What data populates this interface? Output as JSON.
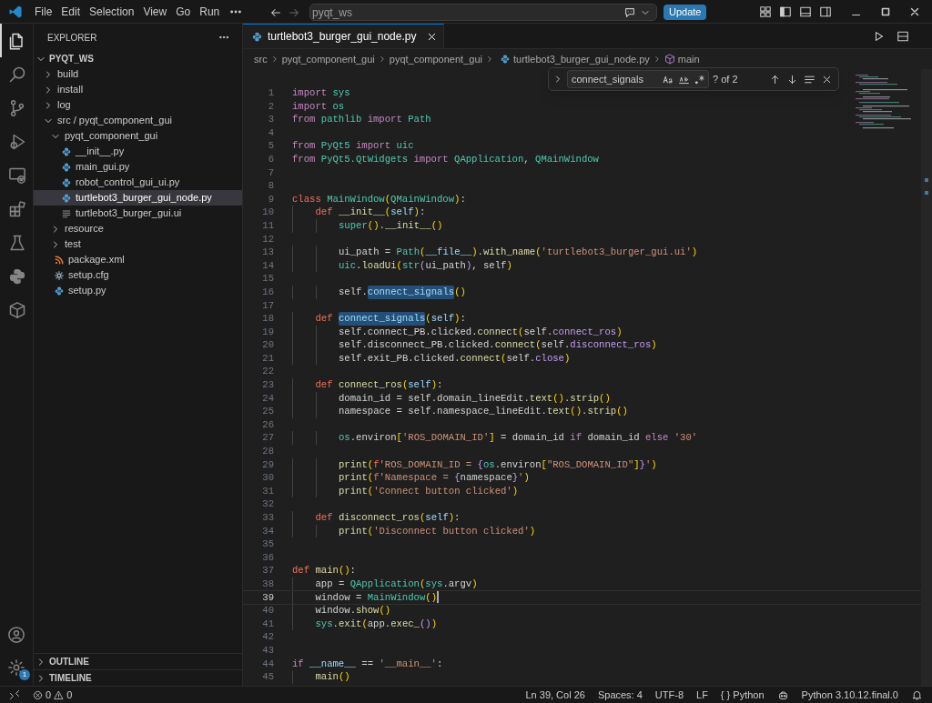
{
  "title_bar": {
    "menu": [
      "File",
      "Edit",
      "Selection",
      "View",
      "Go",
      "Run"
    ],
    "command_center": "pyqt_ws",
    "update_button": "Update"
  },
  "activity_bar": [
    {
      "kind": "files",
      "selected": true
    },
    {
      "kind": "search",
      "selected": false
    },
    {
      "kind": "source-control",
      "selected": false
    },
    {
      "kind": "debug",
      "selected": false
    },
    {
      "kind": "remote",
      "selected": false
    },
    {
      "kind": "extensions",
      "selected": false
    },
    {
      "kind": "testing",
      "selected": false
    },
    {
      "kind": "python",
      "selected": false
    },
    {
      "kind": "cube",
      "selected": false
    }
  ],
  "settings_badge": "1",
  "sidebar": {
    "title": "EXPLORER",
    "root": {
      "label": "PYQT_WS",
      "expanded": true
    },
    "tree": [
      {
        "label": "build",
        "kind": "folder",
        "expanded": false,
        "selected": false
      },
      {
        "label": "install",
        "kind": "folder",
        "expanded": false,
        "selected": false
      },
      {
        "label": "log",
        "kind": "folder",
        "expanded": false,
        "selected": false
      },
      {
        "label": "src / pyqt_component_gui",
        "kind": "folder",
        "expanded": true,
        "selected": false,
        "children": [
          {
            "label": "pyqt_component_gui",
            "kind": "folder",
            "expanded": true,
            "selected": false,
            "children": [
              {
                "label": "__init__.py",
                "kind": "python",
                "selected": false
              },
              {
                "label": "main_gui.py",
                "kind": "python",
                "selected": false
              },
              {
                "label": "robot_control_gui_ui.py",
                "kind": "python",
                "selected": false
              },
              {
                "label": "turtlebot3_burger_gui_node.py",
                "kind": "python",
                "selected": true
              },
              {
                "label": "turtlebot3_burger_gui.ui",
                "kind": "text",
                "selected": false
              }
            ]
          },
          {
            "label": "resource",
            "kind": "folder",
            "expanded": false,
            "selected": false
          },
          {
            "label": "test",
            "kind": "folder",
            "expanded": false,
            "selected": false
          },
          {
            "label": "package.xml",
            "kind": "xml",
            "selected": false
          },
          {
            "label": "setup.cfg",
            "kind": "gear",
            "selected": false
          },
          {
            "label": "setup.py",
            "kind": "python",
            "selected": false
          }
        ]
      }
    ],
    "sections": [
      {
        "label": "OUTLINE",
        "expanded": false
      },
      {
        "label": "TIMELINE",
        "expanded": false
      }
    ]
  },
  "tabs": [
    {
      "label": "turtlebot3_burger_gui_node.py",
      "kind": "python",
      "selected": true
    }
  ],
  "breadcrumbs": [
    {
      "label": "src",
      "kind": "folder"
    },
    {
      "label": "pyqt_component_gui",
      "kind": "folder"
    },
    {
      "label": "pyqt_component_gui",
      "kind": "folder"
    },
    {
      "label": "turtlebot3_burger_gui_node.py",
      "kind": "python"
    },
    {
      "label": "main",
      "kind": "symbol"
    }
  ],
  "find": {
    "value": "connect_signals",
    "count": "? of 2"
  },
  "code": [
    {
      "number": "1",
      "current": false,
      "tokens": [
        {
          "kind": "k",
          "text": "import "
        },
        {
          "kind": "t",
          "text": "sys"
        }
      ]
    },
    {
      "number": "2",
      "current": false,
      "tokens": [
        {
          "kind": "k",
          "text": "import "
        },
        {
          "kind": "t",
          "text": "os"
        }
      ]
    },
    {
      "number": "3",
      "current": false,
      "tokens": [
        {
          "kind": "k",
          "text": "from "
        },
        {
          "kind": "t",
          "text": "pathlib "
        },
        {
          "kind": "k",
          "text": "import "
        },
        {
          "kind": "t",
          "text": "Path"
        }
      ]
    },
    {
      "number": "4",
      "current": false
    },
    {
      "number": "5",
      "current": false,
      "tokens": [
        {
          "kind": "k",
          "text": "from "
        },
        {
          "kind": "t",
          "text": "PyQt5 "
        },
        {
          "kind": "k",
          "text": "import "
        },
        {
          "kind": "t",
          "text": "uic"
        }
      ]
    },
    {
      "number": "6",
      "current": false,
      "tokens": [
        {
          "kind": "k",
          "text": "from "
        },
        {
          "kind": "t",
          "text": "PyQt5.QtWidgets "
        },
        {
          "kind": "k",
          "text": "import "
        },
        {
          "kind": "t",
          "text": "QApplication"
        },
        {
          "kind": "p",
          "text": ", "
        },
        {
          "kind": "t",
          "text": "QMainWindow"
        }
      ]
    },
    {
      "number": "7",
      "current": false
    },
    {
      "number": "8",
      "current": false
    },
    {
      "number": "9",
      "current": false,
      "tokens": [
        {
          "kind": "d",
          "text": "class "
        },
        {
          "kind": "t",
          "text": "MainWindow"
        },
        {
          "kind": "b",
          "text": "("
        },
        {
          "kind": "t",
          "text": "QMainWindow"
        },
        {
          "kind": "b",
          "text": ")"
        },
        {
          "kind": "p",
          "text": ":"
        }
      ]
    },
    {
      "number": "10",
      "current": false,
      "tokens": [
        {
          "kind": "d",
          "text": "    def "
        },
        {
          "kind": "f",
          "text": "__init__"
        },
        {
          "kind": "b",
          "text": "("
        },
        {
          "kind": "v",
          "text": "self"
        },
        {
          "kind": "b",
          "text": ")"
        },
        {
          "kind": "p",
          "text": ":"
        }
      ]
    },
    {
      "number": "11",
      "current": false,
      "tokens": [
        {
          "kind": "t",
          "text": "        super"
        },
        {
          "kind": "b",
          "text": "()"
        },
        {
          "kind": "p",
          "text": "."
        },
        {
          "kind": "f",
          "text": "__init__"
        },
        {
          "kind": "b",
          "text": "()"
        }
      ]
    },
    {
      "number": "12",
      "current": false
    },
    {
      "number": "13",
      "current": false,
      "tokens": [
        {
          "kind": "p",
          "text": "        ui_path = "
        },
        {
          "kind": "t",
          "text": "Path"
        },
        {
          "kind": "b",
          "text": "("
        },
        {
          "kind": "v",
          "text": "__file__"
        },
        {
          "kind": "b",
          "text": ")"
        },
        {
          "kind": "p",
          "text": "."
        },
        {
          "kind": "f",
          "text": "with_name"
        },
        {
          "kind": "b",
          "text": "("
        },
        {
          "kind": "s",
          "text": "'turtlebot3_burger_gui.ui'"
        },
        {
          "kind": "b",
          "text": ")"
        }
      ]
    },
    {
      "number": "14",
      "current": false,
      "tokens": [
        {
          "kind": "t",
          "text": "        uic"
        },
        {
          "kind": "p",
          "text": "."
        },
        {
          "kind": "f",
          "text": "loadUi"
        },
        {
          "kind": "b",
          "text": "("
        },
        {
          "kind": "t",
          "text": "str"
        },
        {
          "kind": "m",
          "text": "("
        },
        {
          "kind": "p",
          "text": "ui_path"
        },
        {
          "kind": "m",
          "text": ")"
        },
        {
          "kind": "p",
          "text": ", self"
        },
        {
          "kind": "b",
          "text": ")"
        }
      ]
    },
    {
      "number": "15",
      "current": false
    },
    {
      "number": "16",
      "current": false,
      "tokens": [
        {
          "kind": "p",
          "text": "        self."
        },
        {
          "kind": "match",
          "text": "connect_signals"
        },
        {
          "kind": "b",
          "text": "()"
        }
      ]
    },
    {
      "number": "17",
      "current": false
    },
    {
      "number": "18",
      "current": false,
      "tokens": [
        {
          "kind": "d",
          "text": "    def "
        },
        {
          "kind": "match",
          "text": "connect_signals"
        },
        {
          "kind": "b",
          "text": "("
        },
        {
          "kind": "v",
          "text": "self"
        },
        {
          "kind": "b",
          "text": ")"
        },
        {
          "kind": "p",
          "text": ":"
        }
      ]
    },
    {
      "number": "19",
      "current": false,
      "tokens": [
        {
          "kind": "p",
          "text": "        self.connect_PB.clicked."
        },
        {
          "kind": "f",
          "text": "connect"
        },
        {
          "kind": "b",
          "text": "("
        },
        {
          "kind": "p",
          "text": "self."
        },
        {
          "kind": "m",
          "text": "connect_ros"
        },
        {
          "kind": "b",
          "text": ")"
        }
      ]
    },
    {
      "number": "20",
      "current": false,
      "tokens": [
        {
          "kind": "p",
          "text": "        self.disconnect_PB.clicked."
        },
        {
          "kind": "f",
          "text": "connect"
        },
        {
          "kind": "b",
          "text": "("
        },
        {
          "kind": "p",
          "text": "self."
        },
        {
          "kind": "m",
          "text": "disconnect_ros"
        },
        {
          "kind": "b",
          "text": ")"
        }
      ]
    },
    {
      "number": "21",
      "current": false,
      "tokens": [
        {
          "kind": "p",
          "text": "        self.exit_PB.clicked."
        },
        {
          "kind": "f",
          "text": "connect"
        },
        {
          "kind": "b",
          "text": "("
        },
        {
          "kind": "p",
          "text": "self."
        },
        {
          "kind": "m",
          "text": "close"
        },
        {
          "kind": "b",
          "text": ")"
        }
      ]
    },
    {
      "number": "22",
      "current": false
    },
    {
      "number": "23",
      "current": false,
      "tokens": [
        {
          "kind": "d",
          "text": "    def "
        },
        {
          "kind": "f",
          "text": "connect_ros"
        },
        {
          "kind": "b",
          "text": "("
        },
        {
          "kind": "v",
          "text": "self"
        },
        {
          "kind": "b",
          "text": ")"
        },
        {
          "kind": "p",
          "text": ":"
        }
      ]
    },
    {
      "number": "24",
      "current": false,
      "tokens": [
        {
          "kind": "p",
          "text": "        domain_id = self.domain_lineEdit."
        },
        {
          "kind": "f",
          "text": "text"
        },
        {
          "kind": "b",
          "text": "()"
        },
        {
          "kind": "p",
          "text": "."
        },
        {
          "kind": "f",
          "text": "strip"
        },
        {
          "kind": "b",
          "text": "()"
        }
      ]
    },
    {
      "number": "25",
      "current": false,
      "tokens": [
        {
          "kind": "p",
          "text": "        namespace = self.namespace_lineEdit."
        },
        {
          "kind": "f",
          "text": "text"
        },
        {
          "kind": "b",
          "text": "()"
        },
        {
          "kind": "p",
          "text": "."
        },
        {
          "kind": "f",
          "text": "strip"
        },
        {
          "kind": "b",
          "text": "()"
        }
      ]
    },
    {
      "number": "26",
      "current": false
    },
    {
      "number": "27",
      "current": false,
      "tokens": [
        {
          "kind": "t",
          "text": "        os"
        },
        {
          "kind": "p",
          "text": ".environ"
        },
        {
          "kind": "b",
          "text": "["
        },
        {
          "kind": "s",
          "text": "'ROS_DOMAIN_ID'"
        },
        {
          "kind": "b",
          "text": "]"
        },
        {
          "kind": "p",
          "text": " = domain_id "
        },
        {
          "kind": "k",
          "text": "if"
        },
        {
          "kind": "p",
          "text": " domain_id "
        },
        {
          "kind": "k",
          "text": "else "
        },
        {
          "kind": "s",
          "text": "'30'"
        }
      ]
    },
    {
      "number": "28",
      "current": false
    },
    {
      "number": "29",
      "current": false,
      "tokens": [
        {
          "kind": "f",
          "text": "        print"
        },
        {
          "kind": "b",
          "text": "("
        },
        {
          "kind": "d",
          "text": "f"
        },
        {
          "kind": "s",
          "text": "'ROS_DOMAIN_ID = "
        },
        {
          "kind": "m",
          "text": "{"
        },
        {
          "kind": "t",
          "text": "os"
        },
        {
          "kind": "p",
          "text": ".environ"
        },
        {
          "kind": "b",
          "text": "["
        },
        {
          "kind": "s",
          "text": "\"ROS_DOMAIN_ID\""
        },
        {
          "kind": "b",
          "text": "]"
        },
        {
          "kind": "m",
          "text": "}"
        },
        {
          "kind": "s",
          "text": "'"
        },
        {
          "kind": "b",
          "text": ")"
        }
      ]
    },
    {
      "number": "30",
      "current": false,
      "tokens": [
        {
          "kind": "f",
          "text": "        print"
        },
        {
          "kind": "b",
          "text": "("
        },
        {
          "kind": "d",
          "text": "f"
        },
        {
          "kind": "s",
          "text": "'Namespace = "
        },
        {
          "kind": "m",
          "text": "{"
        },
        {
          "kind": "p",
          "text": "namespace"
        },
        {
          "kind": "m",
          "text": "}"
        },
        {
          "kind": "s",
          "text": "'"
        },
        {
          "kind": "b",
          "text": ")"
        }
      ]
    },
    {
      "number": "31",
      "current": false,
      "tokens": [
        {
          "kind": "f",
          "text": "        print"
        },
        {
          "kind": "b",
          "text": "("
        },
        {
          "kind": "s",
          "text": "'Connect button clicked'"
        },
        {
          "kind": "b",
          "text": ")"
        }
      ]
    },
    {
      "number": "32",
      "current": false
    },
    {
      "number": "33",
      "current": false,
      "tokens": [
        {
          "kind": "d",
          "text": "    def "
        },
        {
          "kind": "f",
          "text": "disconnect_ros"
        },
        {
          "kind": "b",
          "text": "("
        },
        {
          "kind": "v",
          "text": "self"
        },
        {
          "kind": "b",
          "text": ")"
        },
        {
          "kind": "p",
          "text": ":"
        }
      ]
    },
    {
      "number": "34",
      "current": false,
      "tokens": [
        {
          "kind": "f",
          "text": "        print"
        },
        {
          "kind": "b",
          "text": "("
        },
        {
          "kind": "s",
          "text": "'Disconnect button clicked'"
        },
        {
          "kind": "b",
          "text": ")"
        }
      ]
    },
    {
      "number": "35",
      "current": false
    },
    {
      "number": "36",
      "current": false
    },
    {
      "number": "37",
      "current": false,
      "tokens": [
        {
          "kind": "d",
          "text": "def "
        },
        {
          "kind": "f",
          "text": "main"
        },
        {
          "kind": "b",
          "text": "()"
        },
        {
          "kind": "p",
          "text": ":"
        }
      ]
    },
    {
      "number": "38",
      "current": false,
      "tokens": [
        {
          "kind": "p",
          "text": "    app = "
        },
        {
          "kind": "t",
          "text": "QApplication"
        },
        {
          "kind": "b",
          "text": "("
        },
        {
          "kind": "t",
          "text": "sys"
        },
        {
          "kind": "p",
          "text": ".argv"
        },
        {
          "kind": "b",
          "text": ")"
        }
      ]
    },
    {
      "number": "39",
      "current": true,
      "tokens": [
        {
          "kind": "p",
          "text": "    window = "
        },
        {
          "kind": "t",
          "text": "MainWindow"
        },
        {
          "kind": "b",
          "text": "()"
        }
      ]
    },
    {
      "number": "40",
      "current": false,
      "tokens": [
        {
          "kind": "p",
          "text": "    window."
        },
        {
          "kind": "f",
          "text": "show"
        },
        {
          "kind": "b",
          "text": "()"
        }
      ]
    },
    {
      "number": "41",
      "current": false,
      "tokens": [
        {
          "kind": "t",
          "text": "    sys"
        },
        {
          "kind": "p",
          "text": "."
        },
        {
          "kind": "f",
          "text": "exit"
        },
        {
          "kind": "b",
          "text": "("
        },
        {
          "kind": "p",
          "text": "app."
        },
        {
          "kind": "f",
          "text": "exec_"
        },
        {
          "kind": "m",
          "text": "()"
        },
        {
          "kind": "b",
          "text": ")"
        }
      ]
    },
    {
      "number": "42",
      "current": false
    },
    {
      "number": "43",
      "current": false
    },
    {
      "number": "44",
      "current": false,
      "tokens": [
        {
          "kind": "k",
          "text": "if "
        },
        {
          "kind": "v",
          "text": "__name__"
        },
        {
          "kind": "p",
          "text": " == "
        },
        {
          "kind": "s",
          "text": "'__main__'"
        },
        {
          "kind": "p",
          "text": ":"
        }
      ]
    },
    {
      "number": "45",
      "current": false,
      "tokens": [
        {
          "kind": "f",
          "text": "    main"
        },
        {
          "kind": "b",
          "text": "()"
        }
      ]
    }
  ],
  "status_bar": {
    "errors": "0",
    "warnings": "0",
    "right": [
      "Ln 39, Col 26",
      "Spaces: 4",
      "UTF-8",
      "LF",
      "{ } Python"
    ],
    "interpreter": "Python 3.10.12.final.0"
  }
}
